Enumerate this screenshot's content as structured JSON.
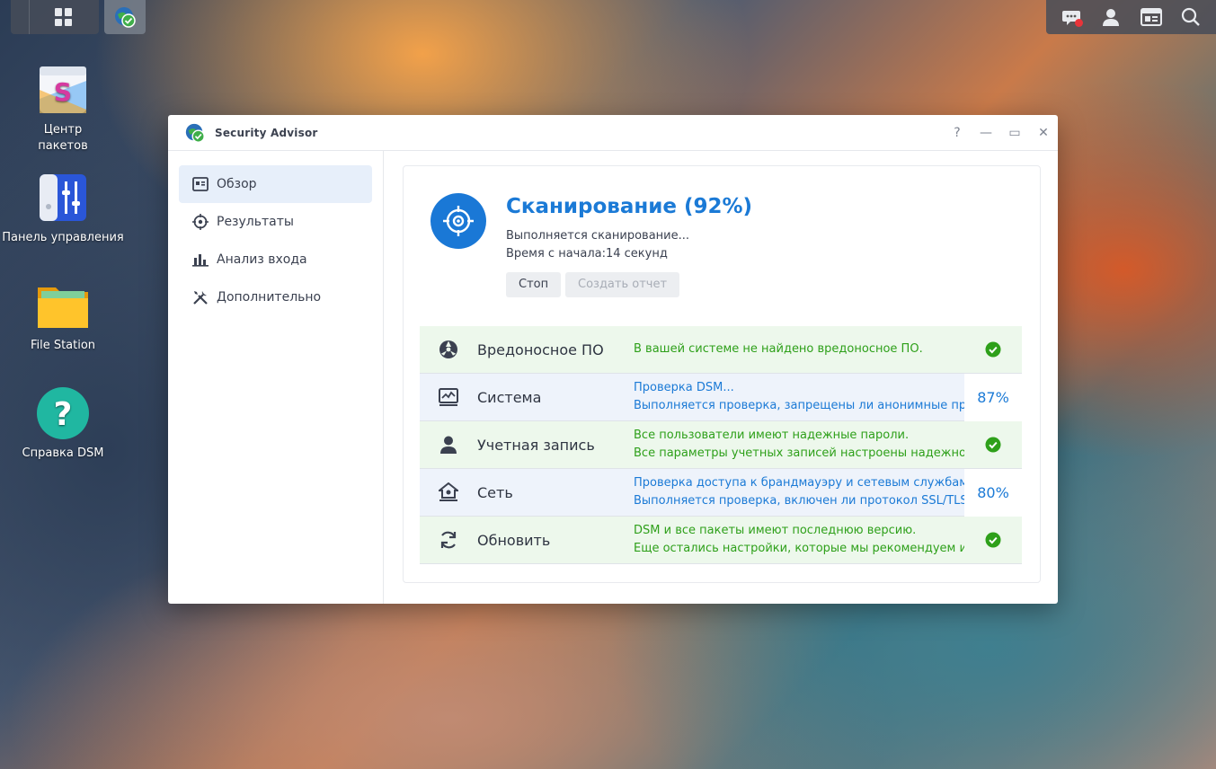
{
  "taskbar": {
    "left_icon": "apps-grid-icon",
    "app_icon": "security-advisor-icon",
    "right_icons": [
      "chat-notification-icon",
      "user-icon",
      "widgets-icon",
      "search-icon"
    ]
  },
  "desktop": {
    "icons": [
      {
        "label": "Центр пакетов",
        "line1": "Центр",
        "line2": "пакетов",
        "icon": "package-center-icon"
      },
      {
        "label": "Панель управления",
        "icon": "control-panel-icon"
      },
      {
        "label": "File Station",
        "icon": "folder-icon"
      },
      {
        "label": "Справка DSM",
        "icon": "help-icon"
      }
    ]
  },
  "window": {
    "title": "Security Advisor",
    "controls": {
      "help": "?",
      "minimize": "—",
      "maximize": "▭",
      "close": "✕"
    }
  },
  "sidebar": {
    "items": [
      {
        "label": "Обзор",
        "icon": "overview-icon",
        "active": true
      },
      {
        "label": "Результаты",
        "icon": "results-icon"
      },
      {
        "label": "Анализ входа",
        "icon": "login-analysis-icon"
      },
      {
        "label": "Дополнительно",
        "icon": "tools-icon"
      }
    ]
  },
  "scan": {
    "title": "Сканирование (92%)",
    "status": "Выполняется сканирование...",
    "elapsed": "Время с начала:14 секунд",
    "stop_label": "Стоп",
    "report_label": "Создать отчет"
  },
  "categories": [
    {
      "name": "Вредоносное ПО",
      "icon": "malware-icon",
      "state": "ok",
      "line1": "В вашей системе не найдено вредоносное ПО.",
      "line2": "",
      "result": "check-icon"
    },
    {
      "name": "Система",
      "icon": "system-icon",
      "state": "running",
      "line1": "Проверка DSM...",
      "line2": "Выполняется проверка, запрещены ли анонимные пр",
      "result": "87%"
    },
    {
      "name": "Учетная запись",
      "icon": "account-icon",
      "state": "ok",
      "line1": "Все пользователи имеют надежные пароли.",
      "line2": "Все параметры учетных записей настроены надежно.",
      "result": "check-icon"
    },
    {
      "name": "Сеть",
      "icon": "network-icon",
      "state": "running",
      "line1": "Проверка доступа к брандмауэру и сетевым службам.",
      "line2": "Выполняется проверка, включен ли протокол SSL/TLS",
      "result": "80%"
    },
    {
      "name": "Обновить",
      "icon": "update-icon",
      "state": "ok",
      "line1": "DSM и все пакеты имеют последнюю версию.",
      "line2": "Еще остались настройки, которые мы рекомендуем из",
      "result": "check-icon"
    }
  ],
  "colors": {
    "accent": "#1b7ad6",
    "ok": "#2ea01a",
    "ok_bg": "#edf8ec",
    "run_bg": "#eef3fb"
  }
}
